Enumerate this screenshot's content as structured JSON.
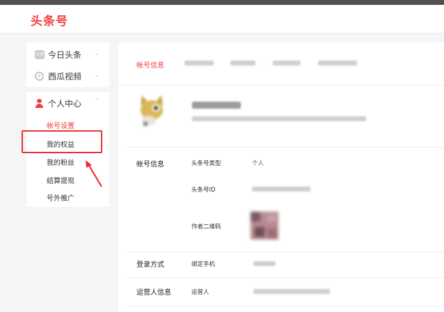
{
  "header": {
    "logo": "头条号"
  },
  "sidebar": {
    "top_items": [
      {
        "label": "今日头条",
        "icon": "toutiao-icon"
      },
      {
        "label": "西瓜视频",
        "icon": "play-icon"
      }
    ],
    "personal": {
      "label": "个人中心",
      "icon": "person-icon",
      "items": [
        {
          "label": "帐号设置",
          "active": true
        },
        {
          "label": "我的权益",
          "highlighted": true
        },
        {
          "label": "我的粉丝"
        },
        {
          "label": "结算提现"
        },
        {
          "label": "号外推广"
        }
      ]
    }
  },
  "main": {
    "tabs": [
      {
        "label": "帐号信息",
        "active": true
      }
    ],
    "account_info": {
      "title": "帐号信息",
      "type_label": "头条号类型",
      "type_value": "个人",
      "id_label": "头条号ID",
      "qr_label": "作者二维码"
    },
    "login": {
      "title": "登录方式",
      "phone_label": "绑定手机"
    },
    "operator": {
      "title": "运营人信息",
      "name_label": "运营人"
    }
  },
  "colors": {
    "brand": "#f04142",
    "annotation": "#e9322e"
  }
}
